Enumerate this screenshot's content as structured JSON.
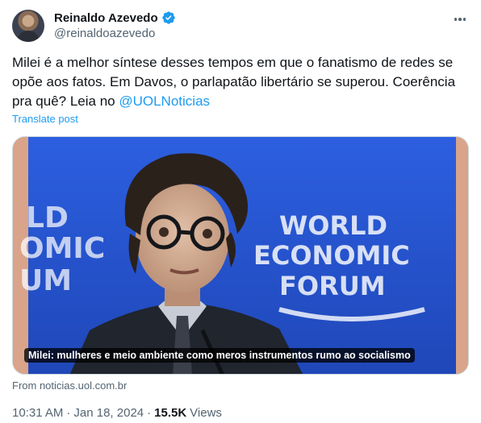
{
  "author": {
    "display_name": "Reinaldo Azevedo",
    "handle": "@reinaldoazevedo",
    "verified": true
  },
  "post": {
    "text_main": "Milei é a melhor síntese desses tempos em que o fanatismo de redes se opõe aos fatos. Em Davos, o parlapatão libertário se superou. Coerência pra quê? Leia no ",
    "mention": "@UOLNoticias",
    "translate_label": "Translate post"
  },
  "card": {
    "caption": "Milei: mulheres e meio ambiente como meros instrumentos rumo ao socialismo",
    "backdrop_text_left": [
      "LD",
      "OMIC",
      "UM"
    ],
    "backdrop_text_right": [
      "WORLD",
      "ECONOMIC",
      "FORUM"
    ],
    "source": "From noticias.uol.com.br"
  },
  "meta": {
    "time": "10:31 AM",
    "dot1": "·",
    "date": "Jan 18, 2024",
    "dot2": "·",
    "views_count": "15.5K",
    "views_label": "Views"
  },
  "colors": {
    "accent": "#1d9bf0",
    "secondary_text": "#536471",
    "stage_blue": "#2753d4"
  },
  "icons": [
    "verified-badge-icon",
    "more-options-icon"
  ]
}
